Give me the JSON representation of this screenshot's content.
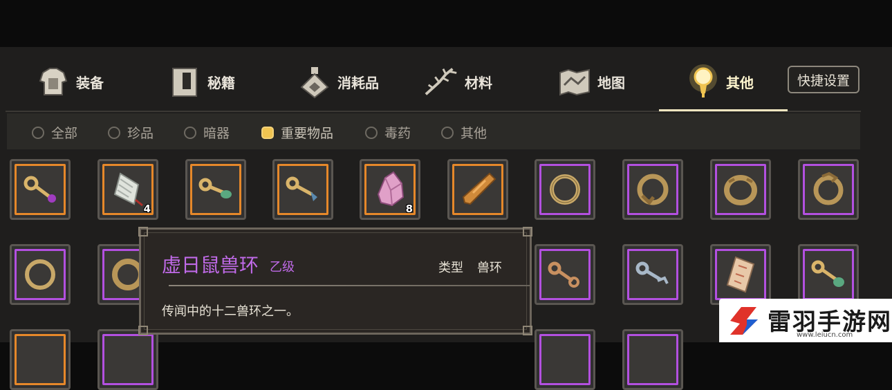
{
  "tabs": [
    {
      "label": "装备",
      "icon": "armor-icon"
    },
    {
      "label": "秘籍",
      "icon": "book-icon"
    },
    {
      "label": "消耗品",
      "icon": "potion-icon"
    },
    {
      "label": "材料",
      "icon": "herb-icon"
    },
    {
      "label": "地图",
      "icon": "map-icon"
    },
    {
      "label": "其他",
      "icon": "lamp-icon",
      "active": true
    }
  ],
  "quick_settings": "快捷设置",
  "filters": [
    {
      "label": "全部"
    },
    {
      "label": "珍品"
    },
    {
      "label": "暗器"
    },
    {
      "label": "重要物品",
      "selected": true
    },
    {
      "label": "毒药"
    },
    {
      "label": "其他"
    }
  ],
  "items": {
    "row1": [
      {
        "name": "key-purple",
        "rarity": "orange"
      },
      {
        "name": "jade-tablet",
        "rarity": "orange",
        "count": "4"
      },
      {
        "name": "key-green",
        "rarity": "orange"
      },
      {
        "name": "key-blue",
        "rarity": "orange"
      },
      {
        "name": "pink-crystal",
        "rarity": "orange",
        "count": "8"
      },
      {
        "name": "wooden-club",
        "rarity": "orange"
      },
      {
        "name": "ring-plain",
        "rarity": "purple"
      },
      {
        "name": "ring-rat",
        "rarity": "purple"
      },
      {
        "name": "ring-ox",
        "rarity": "purple"
      },
      {
        "name": "ring-dragon",
        "rarity": "purple"
      }
    ],
    "row2": [
      {
        "name": "ring-plain",
        "rarity": "purple"
      },
      {
        "name": "ring-twisted",
        "rarity": "purple"
      },
      {
        "name": "key-bronze",
        "rarity": "purple"
      },
      {
        "name": "key-silver",
        "rarity": "purple"
      },
      {
        "name": "paper-charm",
        "rarity": "purple"
      },
      {
        "name": "key-green",
        "rarity": "purple"
      }
    ]
  },
  "tooltip": {
    "name": "虚日鼠兽环",
    "grade": "乙级",
    "type_label": "类型",
    "type_value": "兽环",
    "description": "传闻中的十二兽环之一。"
  },
  "watermark": {
    "text": "雷羽手游网",
    "url": "www.leiucn.com"
  },
  "colors": {
    "orange_border": "#e6882a",
    "purple_border": "#b350e0",
    "tooltip_name": "#c06ae8",
    "selected_radio": "#f0c451"
  }
}
